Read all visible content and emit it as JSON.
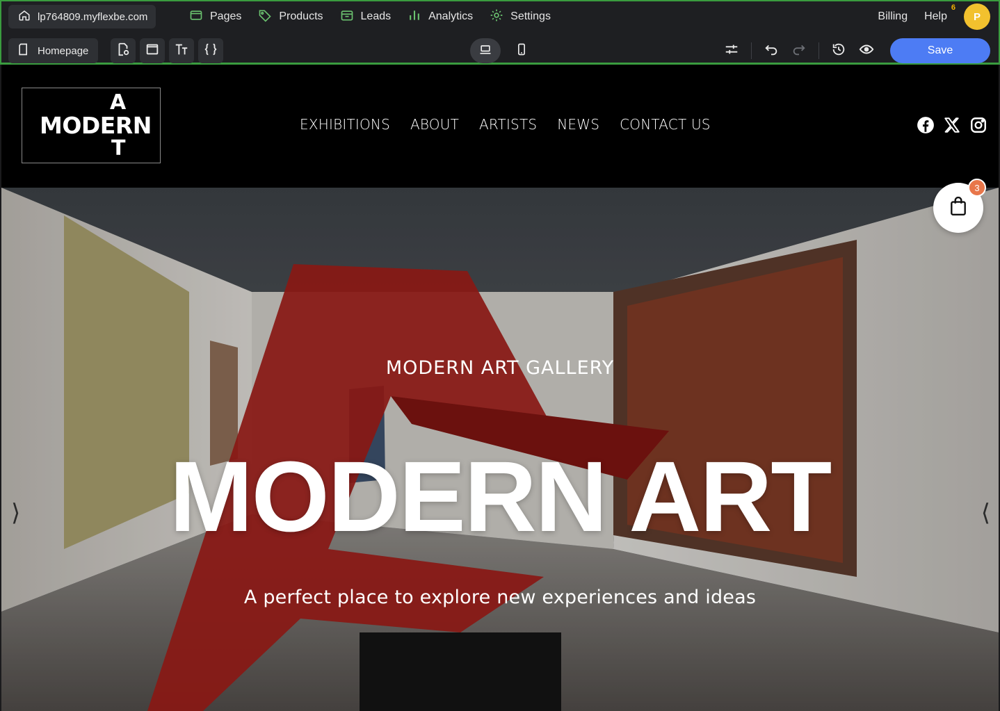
{
  "editor": {
    "site_url": "lp764809.myflexbe.com",
    "nav": [
      {
        "label": "Pages",
        "icon": "pages-icon"
      },
      {
        "label": "Products",
        "icon": "tag-icon"
      },
      {
        "label": "Leads",
        "icon": "inbox-icon"
      },
      {
        "label": "Analytics",
        "icon": "bar-chart-icon"
      },
      {
        "label": "Settings",
        "icon": "gear-icon"
      }
    ],
    "billing_label": "Billing",
    "help_label": "Help",
    "help_badge": "6",
    "avatar_letter": "P",
    "current_page": "Homepage",
    "save_label": "Save",
    "accent_color": "#4d7cf4",
    "nav_icon_color": "#6bc26f"
  },
  "site": {
    "logo": {
      "line1": "A",
      "line2": "MODERN",
      "line3": "T"
    },
    "nav": [
      "EXHIBITIONS",
      "ABOUT",
      "ARTISTS",
      "NEWS",
      "CONTACT US"
    ],
    "socials": [
      "facebook-icon",
      "x-icon",
      "instagram-icon"
    ],
    "hero": {
      "eyebrow": "MODERN ART GALLERY",
      "title": "MODERN ART",
      "subtitle": "A perfect place to explore new experiences and ideas"
    },
    "cart_count": "3",
    "slider_prev": "⟩",
    "slider_next": "⟨"
  }
}
